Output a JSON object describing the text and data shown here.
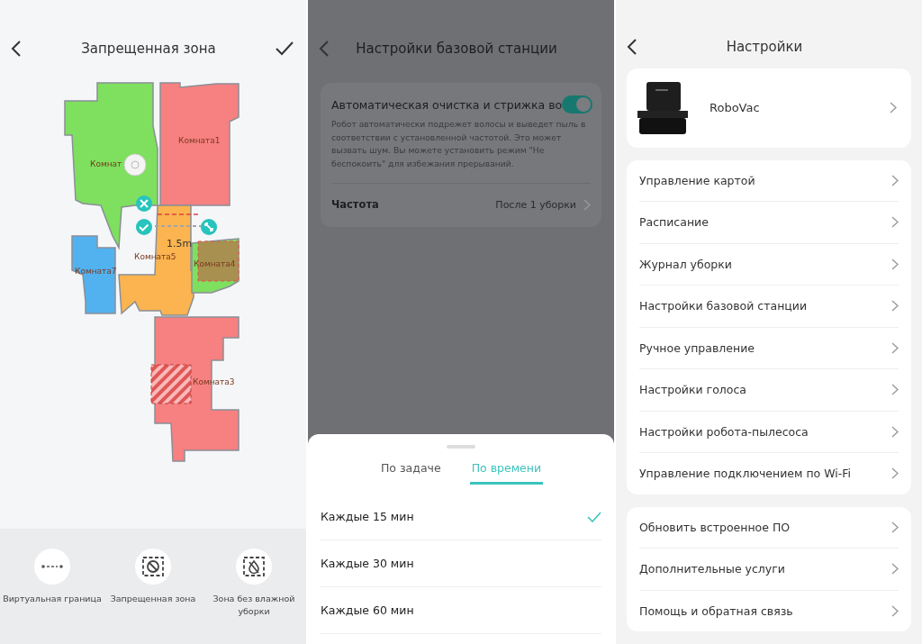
{
  "zone_screen": {
    "title": "Запрещенная зона",
    "rooms": [
      {
        "label": "Комнат",
        "color": "#7ee05e"
      },
      {
        "label": "Комната1",
        "color": "#f78080"
      },
      {
        "label": "Комната5",
        "color": "#fbb44f"
      },
      {
        "label": "Комната7",
        "color": "#52b2f0"
      },
      {
        "label": "Комната4",
        "color": "#7ee05e"
      },
      {
        "label": "Комната3",
        "color": "#f78080"
      }
    ],
    "distance": "1.5m",
    "tools": [
      {
        "label": "Виртуальная граница",
        "kind": "line"
      },
      {
        "label": "Запрещенная зона",
        "kind": "nogo"
      },
      {
        "label": "Зона без влажной уборки",
        "kind": "nomop"
      }
    ]
  },
  "base_station_screen": {
    "title": "Настройки базовой станции",
    "setting": {
      "title": "Автоматическая очистка и стрижка во",
      "on": true,
      "description": "Робот автоматически подрежет волосы и выведет пыль в соответствии с установленной частотой. Это может вызвать шум. Вы можете установить режим \"Не беспокоить\" для избежания прерываний."
    },
    "frequency": {
      "label": "Частота",
      "value": "После 1 уборки"
    },
    "sheet": {
      "tabs": [
        {
          "label": "По задаче",
          "selected": false
        },
        {
          "label": "По времени",
          "selected": true
        }
      ],
      "options": [
        {
          "label": "Каждые 15 мин",
          "selected": true
        },
        {
          "label": "Каждые 30 мин",
          "selected": false
        },
        {
          "label": "Каждые 60 мин",
          "selected": false
        }
      ]
    }
  },
  "settings_screen": {
    "title": "Настройки",
    "device": "RoboVac",
    "groups": [
      [
        "Управление картой",
        "Расписание",
        "Журнал уборки",
        "Настройки базовой станции",
        "Ручное управление",
        "Настройки голоса",
        "Настройки робота-пылесоса",
        "Управление подключением по Wi-Fi"
      ],
      [
        "Обновить встроенное ПО",
        "Дополнительные услуги",
        "Помощь и обратная связь"
      ]
    ]
  }
}
